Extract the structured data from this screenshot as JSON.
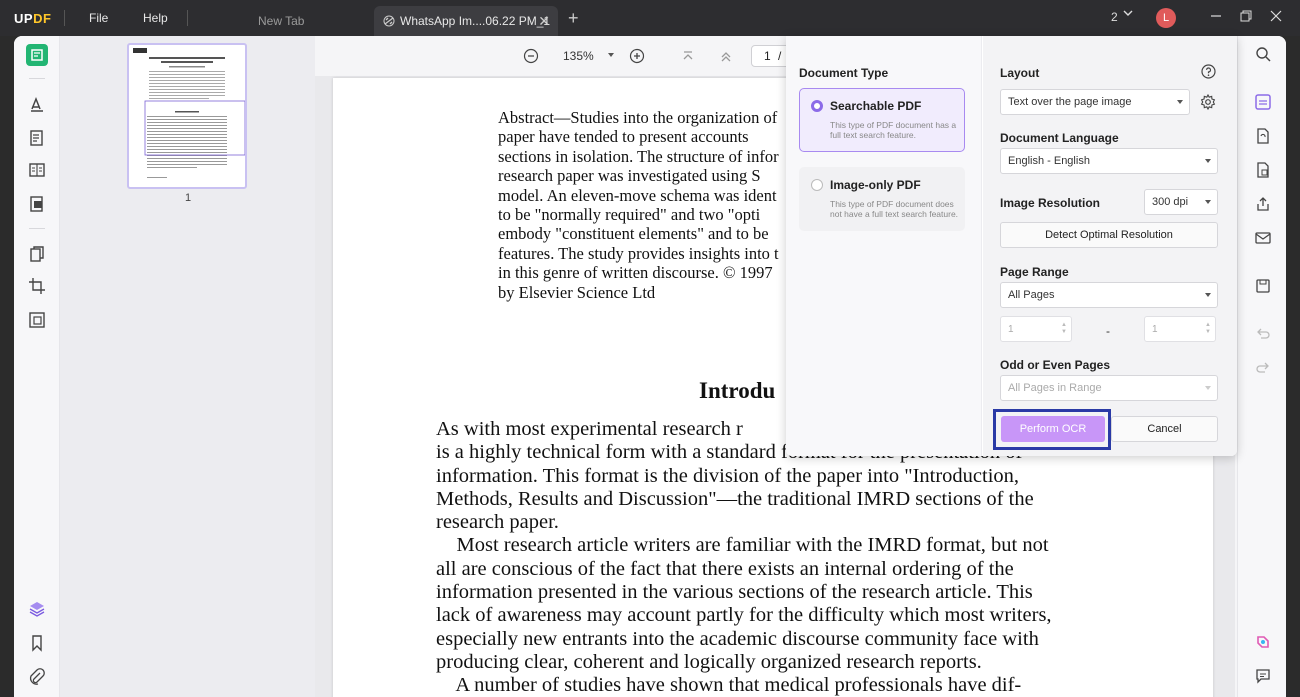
{
  "app": {
    "logo_prefix": "UP",
    "logo_suffix": "DF"
  },
  "menu": {
    "file": "File",
    "help": "Help"
  },
  "tabs": [
    {
      "label": "New Tab"
    },
    {
      "label": "WhatsApp Im....06.22 PM_1"
    }
  ],
  "titlebar": {
    "page_count": "2",
    "avatar_letter": "L"
  },
  "toolbar": {
    "zoom": "135%",
    "page_current": "1",
    "page_sep": "/"
  },
  "thumbnail": {
    "page_number": "1"
  },
  "document": {
    "abstract": "Abstract—Studies into the organization of\npaper have tended to present accounts\nsections in isolation. The structure of infor\nresearch paper was investigated using S\nmodel. An eleven-move schema was ident\nto be \"normally required\" and two \"opti\nembody \"constituent elements\" and to be\nfeatures. The study provides insights into t\nin this genre of written discourse. © 1997 \nby Elsevier Science Ltd",
    "intro_title": "Introdu",
    "body": "As with most experimental research r\nis a highly technical form with a standard format for the presentation of\ninformation. This format is the division of the paper into \"Introduction,\nMethods, Results and Discussion\"—the traditional IMRD sections of the\nresearch paper.\n    Most research article writers are familiar with the IMRD format, but not\nall are conscious of the fact that there exists an internal ordering of the\ninformation presented in the various sections of the research article. This\nlack of awareness may account partly for the difficulty which most writers,\nespecially new entrants into the academic discourse community face with\nproducing clear, coherent and logically organized research reports.\n    A number of studies have shown that medical professionals have dif-"
  },
  "ocr": {
    "document_type_label": "Document Type",
    "options": [
      {
        "title": "Searchable PDF",
        "desc": "This type of PDF document has a full text search feature.",
        "selected": true
      },
      {
        "title": "Image-only PDF",
        "desc": "This type of PDF document does not have a full text search feature.",
        "selected": false
      }
    ],
    "layout_label": "Layout",
    "layout_value": "Text over the page image",
    "language_label": "Document Language",
    "language_value": "English - English",
    "resolution_label": "Image Resolution",
    "resolution_value": "300 dpi",
    "detect_button": "Detect Optimal Resolution",
    "page_range_label": "Page Range",
    "page_range_value": "All Pages",
    "range_from": "1",
    "range_dash": "-",
    "range_to": "1",
    "odd_even_label": "Odd or Even Pages",
    "odd_even_value": "All Pages in Range",
    "perform_button": "Perform OCR",
    "cancel_button": "Cancel"
  },
  "colors": {
    "accent": "#8c6be8",
    "perform_button": "#c896f8",
    "highlight_box": "#2a3aa6",
    "active_tool": "#22b573"
  }
}
